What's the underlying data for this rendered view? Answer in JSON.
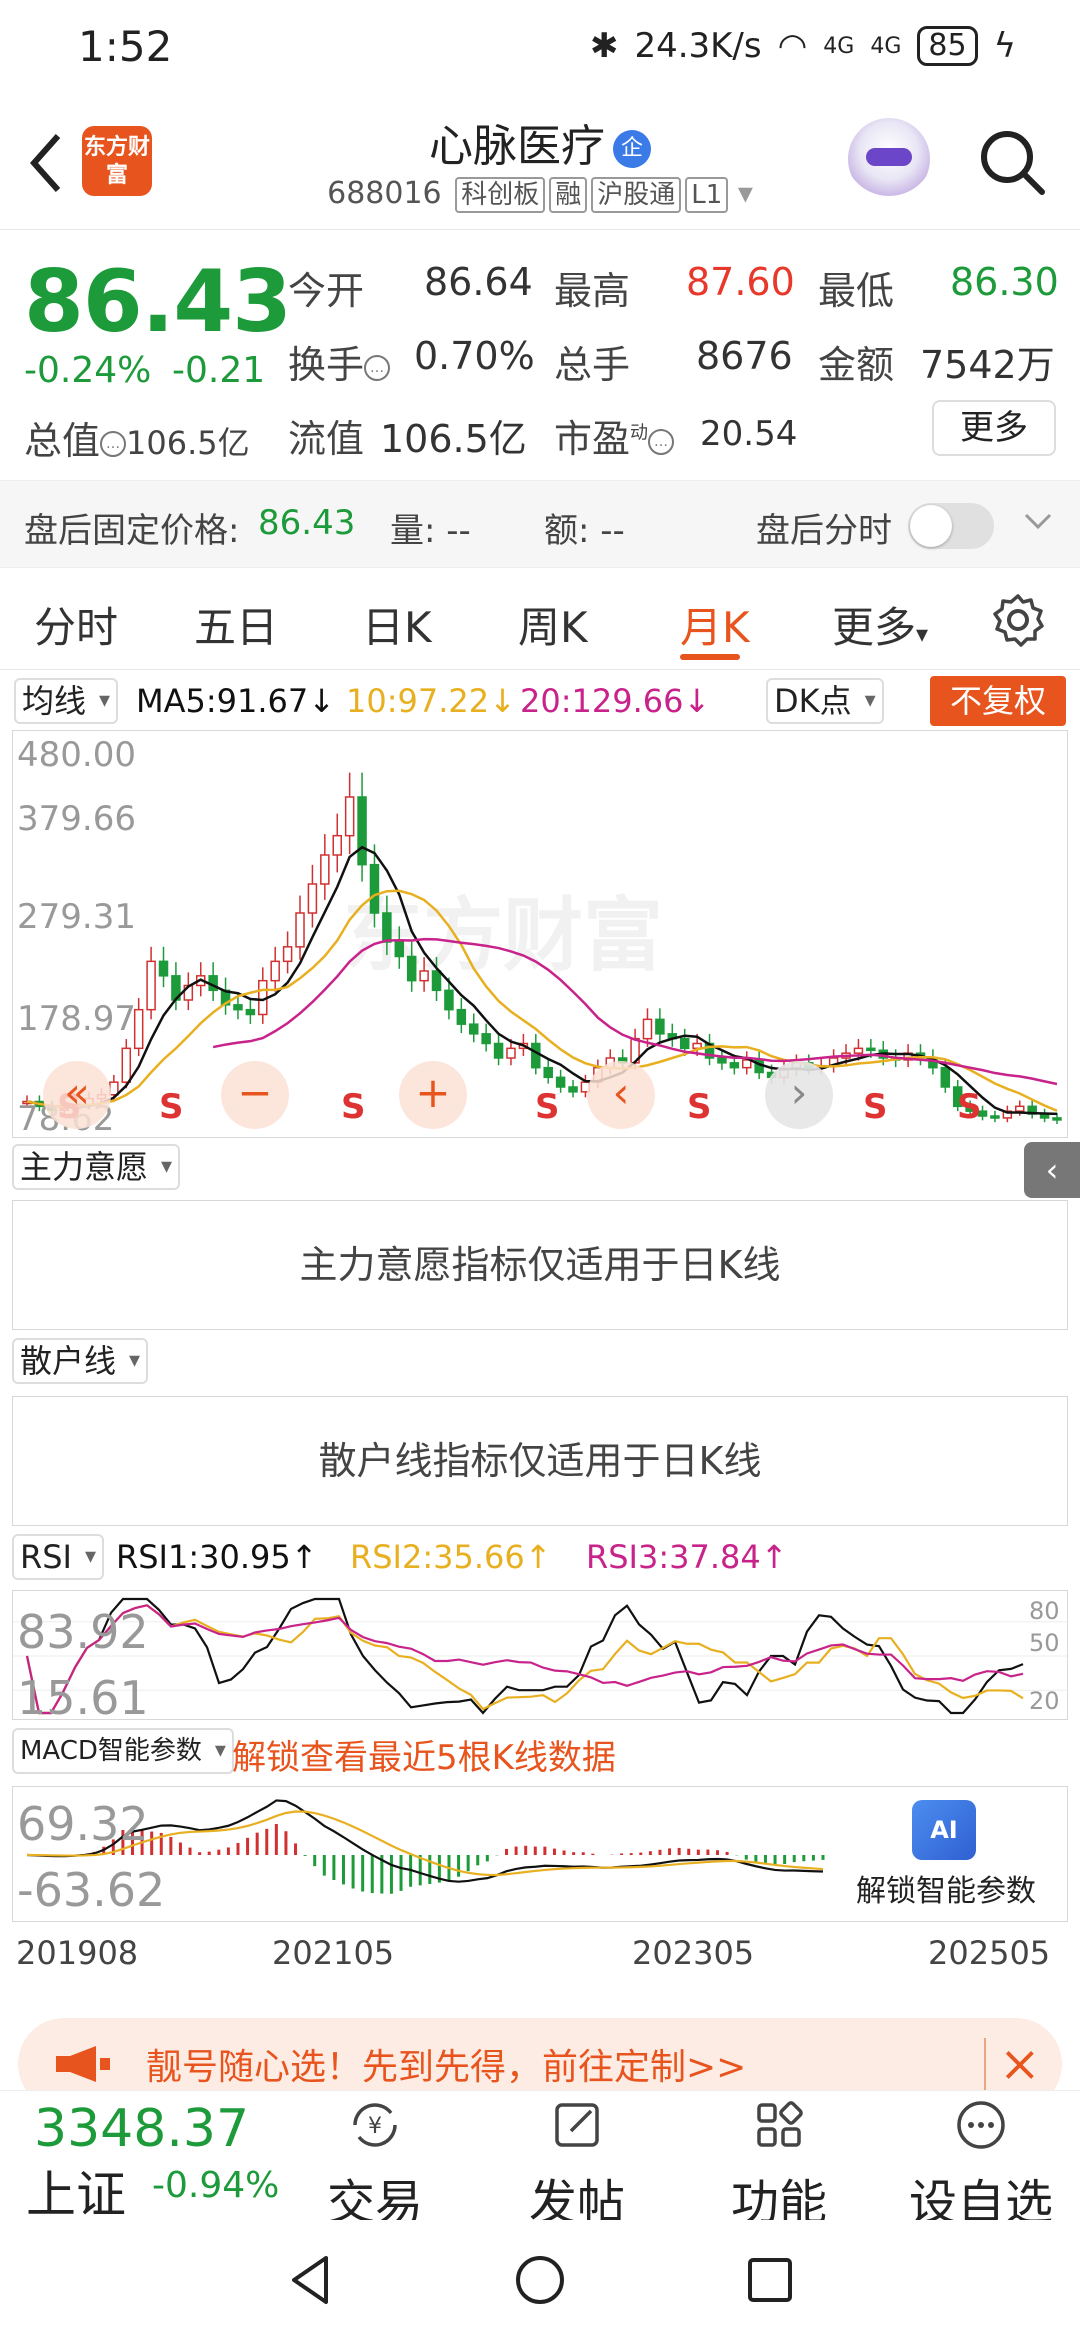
{
  "status_bar": {
    "time": "1:52",
    "net_speed": "24.3K/s",
    "signal1": "4G",
    "signal2": "4G",
    "battery": "85"
  },
  "header": {
    "logo_text": "东方财富",
    "stock_name": "心脉医疗",
    "enterprise_badge": "企",
    "code": "688016",
    "tags": [
      "科创板",
      "融",
      "沪股通",
      "L1"
    ]
  },
  "quote": {
    "price": "86.43",
    "change_pct": "-0.24%",
    "change_abs": "-0.21",
    "total_value_label": "总值",
    "total_value": "106.5亿",
    "rows": [
      {
        "l1": "今开",
        "v1": "86.64",
        "l2": "最高",
        "v2": "87.60",
        "l3": "最低",
        "v3": "86.30"
      },
      {
        "l1": "换手",
        "v1": "0.70%",
        "l2": "总手",
        "v2": "8676",
        "l3": "金额",
        "v3": "7542万"
      },
      {
        "l1": "流值",
        "v1": "106.5亿",
        "l2": "市盈",
        "v2": "20.54",
        "sup": "动"
      }
    ],
    "more_label": "更多"
  },
  "after_hours": {
    "fixed_label": "盘后固定价格:",
    "fixed_price": "86.43",
    "vol_label": "量: --",
    "amt_label": "额: --",
    "intraday_label": "盘后分时"
  },
  "tabs": [
    "分时",
    "五日",
    "日K",
    "周K",
    "月K",
    "更多"
  ],
  "active_tab": "月K",
  "kline": {
    "indicator": "均线",
    "ma5": "MA5:91.67",
    "ma10": "10:97.22",
    "ma20": "20:129.66",
    "dk_label": "DK点",
    "adjust_label": "不复权",
    "y_labels": [
      "480.00",
      "379.66",
      "279.31",
      "178.97",
      "78.62"
    ],
    "signal_letter": "S",
    "controls": {
      "zoom_out": "−",
      "zoom_in": "+",
      "prev": "‹",
      "next": "›"
    },
    "watermark": "东方财富"
  },
  "panel_main_force": {
    "dropdown": "主力意愿",
    "message": "主力意愿指标仅适用于日K线"
  },
  "panel_retail": {
    "dropdown": "散户线",
    "message": "散户线指标仅适用于日K线"
  },
  "rsi": {
    "dropdown": "RSI",
    "rsi1": "RSI1:30.95",
    "rsi2": "RSI2:35.66",
    "rsi3": "RSI3:37.84",
    "y_top": "83.92",
    "y_bottom": "15.61",
    "levels": [
      "80",
      "50",
      "20"
    ]
  },
  "macd": {
    "dropdown": "MACD智能参数",
    "unlock_text": "解锁查看最近5根K线数据",
    "y_top": "69.32",
    "y_bottom": "-63.62",
    "ai_badge": "AI",
    "ai_label": "解锁智能参数"
  },
  "x_labels": [
    "201908",
    "202105",
    "202305",
    "202505"
  ],
  "banner": {
    "text": "靓号随心选！先到先得，前往定制>>"
  },
  "bottom_bar": {
    "index_value": "3348.37",
    "index_name": "上证",
    "index_change": "-0.94%",
    "nav": [
      {
        "label": "交易",
        "icon": "yen-exchange-icon"
      },
      {
        "label": "发帖",
        "icon": "edit-icon"
      },
      {
        "label": "功能",
        "icon": "apps-grid-icon"
      },
      {
        "label": "设自选",
        "icon": "more-dots-icon"
      }
    ]
  },
  "colors": {
    "up": "#e8382b",
    "down": "#1d9a3a",
    "accent": "#e8541d",
    "ma5": "#111111",
    "ma10": "#e8b020",
    "ma20": "#c8238a"
  }
}
